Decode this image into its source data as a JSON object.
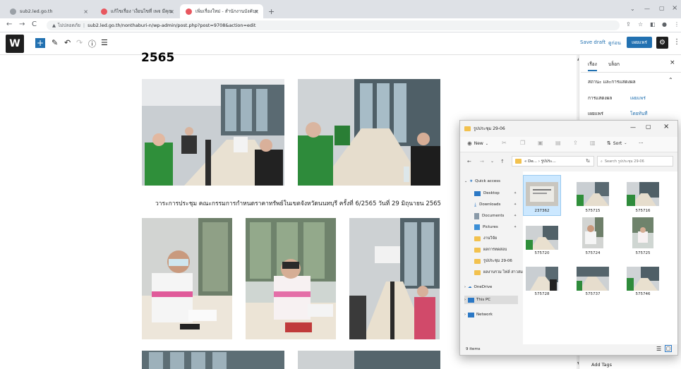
{
  "browser": {
    "tabs": [
      {
        "title": "sub2.led.go.th",
        "active": false
      },
      {
        "title": "แก้ไขเรื่อง 'เงื่อนไขที่ เพจ มีคุณรอบ ไปที่...",
        "active": false
      },
      {
        "title": "เพิ่มเรื่องใหม่ - สำนักงานบังคับคดีจังหวัด...",
        "active": true
      }
    ],
    "new_tab_symbol": "+",
    "security_label": "ไม่ปลอดภัย",
    "url": "sub2.led.go.th/nonthaburi-n/wp-admin/post.php?post=9708&action=edit"
  },
  "wp": {
    "save_draft": "Save draft",
    "preview": "ดูก่อน",
    "publish": "เผยแพร่"
  },
  "content": {
    "heading": "2565",
    "caption": "วาระการประชุม คณะกรรมการกำหนดราคาทรัพย์ในเขตจังหวัดนนทบุรี ครั้งที่ 6/2565 วันที่ 29 มิถุนายน 2565"
  },
  "sidebar": {
    "tabs": [
      "เรื่อง",
      "บล็อก"
    ],
    "section_title": "สถานะ และการแสดงผล",
    "rows": [
      {
        "label": "การแสดงผล",
        "value": "เผยแพร่"
      },
      {
        "label": "เผยแพร่",
        "value": "โดยทันที"
      }
    ],
    "bottom_label": "Add Tags"
  },
  "explorer": {
    "title": "รูปประชุม 29-06",
    "toolbar": {
      "new": "New",
      "sort": "Sort",
      "more": "···"
    },
    "path": "« De... › รูปประ...",
    "search_placeholder": "Search รูปประชุม 29-06",
    "nav": [
      {
        "label": "Quick access",
        "kind": "star"
      },
      {
        "label": "Desktop",
        "kind": "desktop"
      },
      {
        "label": "Downloads",
        "kind": "download"
      },
      {
        "label": "Documents",
        "kind": "doc"
      },
      {
        "label": "Pictures",
        "kind": "pic"
      },
      {
        "label": "งานวิจัย",
        "kind": "folder"
      },
      {
        "label": "ผลการทดสอบ",
        "kind": "folder"
      },
      {
        "label": "รูปประชุม 29-06",
        "kind": "folder"
      },
      {
        "label": "ผลงานรวม ไฟล์ สาวสม",
        "kind": "folder"
      },
      {
        "label": "OneDrive",
        "kind": "cloud"
      },
      {
        "label": "This PC",
        "kind": "pc"
      },
      {
        "label": "Network",
        "kind": "network"
      }
    ],
    "files": [
      "237362",
      "575715",
      "575716",
      "575720",
      "575724",
      "575725",
      "575728",
      "575737",
      "575746"
    ],
    "status": "9 items"
  },
  "colors": {
    "wp_blue": "#2271b1",
    "wp_dark": "#1e1e1e",
    "folder": "#f2c14e",
    "chrome_bg": "#dee1e6"
  }
}
